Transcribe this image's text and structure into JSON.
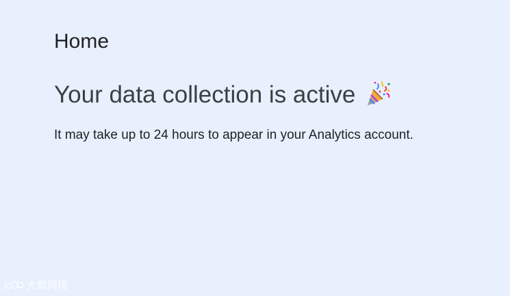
{
  "page": {
    "title": "Home"
  },
  "status": {
    "headline": "Your data collection is active",
    "headline_icon": "party-popper-icon",
    "description": "It may take up to 24 hours to appear in your Analytics account."
  },
  "watermark": {
    "text": "大数跨境"
  },
  "colors": {
    "background": "#e8f0fe",
    "title_text": "#202124",
    "headline_text": "#3c4043"
  }
}
